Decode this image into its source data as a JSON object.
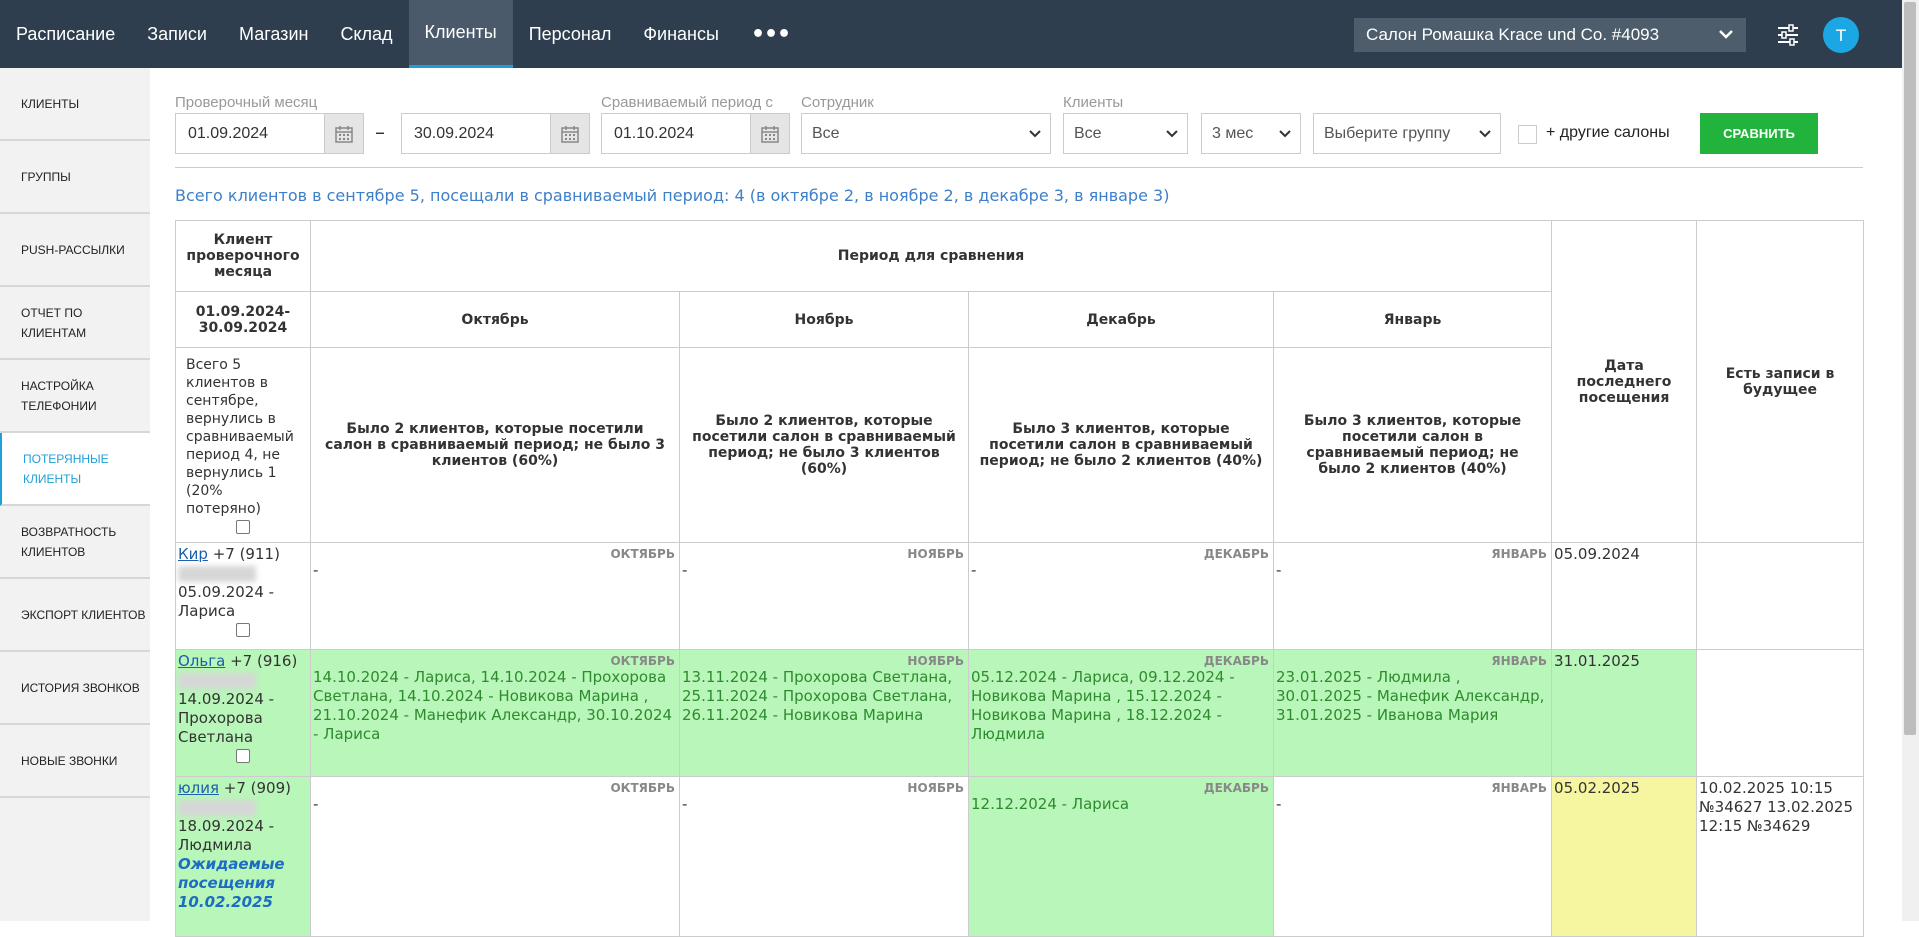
{
  "nav": {
    "items": [
      "Расписание",
      "Записи",
      "Магазин",
      "Склад",
      "Клиенты",
      "Персонал",
      "Финансы"
    ],
    "active": "Клиенты",
    "more": "•••"
  },
  "salon": {
    "selected": "Салон Ромашка Krace und Co. #4093"
  },
  "user": {
    "initial": "T"
  },
  "sidebar": {
    "items": [
      {
        "label": "КЛИЕНТЫ"
      },
      {
        "label": "ГРУППЫ"
      },
      {
        "label": "PUSH-РАССЫЛКИ"
      },
      {
        "label": "ОТЧЕТ ПО КЛИЕНТАМ"
      },
      {
        "label": "НАСТРОЙКА ТЕЛЕФОНИИ"
      },
      {
        "label": "ПОТЕРЯННЫЕ КЛИЕНТЫ"
      },
      {
        "label": "ВОЗВРАТНОСТЬ КЛИЕНТОВ"
      },
      {
        "label": "ЭКСПОРТ КЛИЕНТОВ"
      },
      {
        "label": "ИСТОРИЯ ЗВОНКОВ"
      },
      {
        "label": "НОВЫЕ ЗВОНКИ"
      }
    ],
    "active_index": 5
  },
  "filters": {
    "month_label": "Проверочный месяц",
    "date_from": "01.09.2024",
    "date_to": "30.09.2024",
    "dash": "–",
    "compare_label": "Сравниваемый период с",
    "compare_from": "01.10.2024",
    "employee_label": "Сотрудник",
    "employee_value": "Все",
    "clients_label": "Клиенты",
    "clients_value": "Все",
    "period_value": "3 мес",
    "group_placeholder": "Выберите группу",
    "other_salons_label": "+ другие салоны",
    "compare_button": "СРАВНИТЬ"
  },
  "summary": "Всего клиентов в сентябре 5, посещали в сравниваемый период: 4 (в октябре 2, в ноябре 2, в декабре 3, в январе 3)",
  "table": {
    "client_header": "Клиент проверочного месяца",
    "period_header": "Период для сравнения",
    "date_range": "01.09.2024-30.09.2024",
    "months": [
      "Октябрь",
      "Ноябрь",
      "Декабрь",
      "Январь"
    ],
    "last_visit_header": "Дата последнего посещения",
    "future_header": "Есть записи в будущее",
    "left_desc": "Всего 5 клиентов в сентябре, вернулись в сравниваемый период 4, не вернулись 1 (20% потеряно)",
    "month_descs": [
      "Было 2 клиентов, которые посетили салон в сравниваемый период; не было 3 клиентов (60%)",
      "Было 2 клиентов, которые посетили салон в сравниваемый период; не было 3 клиентов (60%)",
      "Было 3 клиентов, которые посетили салон в сравниваемый период; не было 2 клиентов (40%)",
      "Было 3 клиентов, которые посетили салон в сравниваемый период; не было 2 клиентов (40%)"
    ],
    "month_tags": [
      "ОКТЯБРЬ",
      "НОЯБРЬ",
      "ДЕКАБРЬ",
      "ЯНВАРЬ"
    ],
    "rows": [
      {
        "name": "Кир",
        "phone": "+7 (911)",
        "visit": "05.09.2024 - Лариса",
        "cells": [
          "-",
          "-",
          "-",
          "-"
        ],
        "green": [
          false,
          false,
          false,
          false
        ],
        "last_visit": "05.09.2024",
        "last_visit_style": "none",
        "future": ""
      },
      {
        "name": "Ольга",
        "phone": "+7 (916)",
        "visit": "14.09.2024 - Прохорова Светлана",
        "cells": [
          "14.10.2024 - Лариса, 14.10.2024 - Прохорова Светлана, 14.10.2024 - Новикова Марина , 21.10.2024 - Манефик Александр, 30.10.2024 - Лариса",
          "13.11.2024 - Прохорова Светлана, 25.11.2024 - Прохорова Светлана, 26.11.2024 - Новикова Марина",
          "05.12.2024 - Лариса, 09.12.2024 - Новикова Марина , 15.12.2024 - Новикова Марина , 18.12.2024 - Людмила",
          "23.01.2025 - Людмила , 30.01.2025 - Манефик Александр, 31.01.2025 - Иванова Мария"
        ],
        "green": [
          true,
          true,
          true,
          true
        ],
        "last_visit": "31.01.2025",
        "last_visit_style": "green",
        "future": ""
      },
      {
        "name": "юлия",
        "phone": "+7 (909)",
        "visit": "18.09.2024 - Людмила",
        "expected": "Ожидаемые посещения 10.02.2025",
        "cells": [
          "-",
          "-",
          "12.12.2024 - Лариса",
          "-"
        ],
        "green": [
          false,
          false,
          true,
          false
        ],
        "last_visit": "05.02.2025",
        "last_visit_style": "yellow",
        "future": "10.02.2025 10:15 №34627 13.02.2025 12:15 №34629"
      }
    ]
  },
  "colors": {
    "topbar": "#2e3e4e",
    "accent": "#1fa0d8",
    "compare_button": "#22b33d",
    "green_cell": "#b9f6b9",
    "yellow_cell": "#f6f6a0"
  }
}
